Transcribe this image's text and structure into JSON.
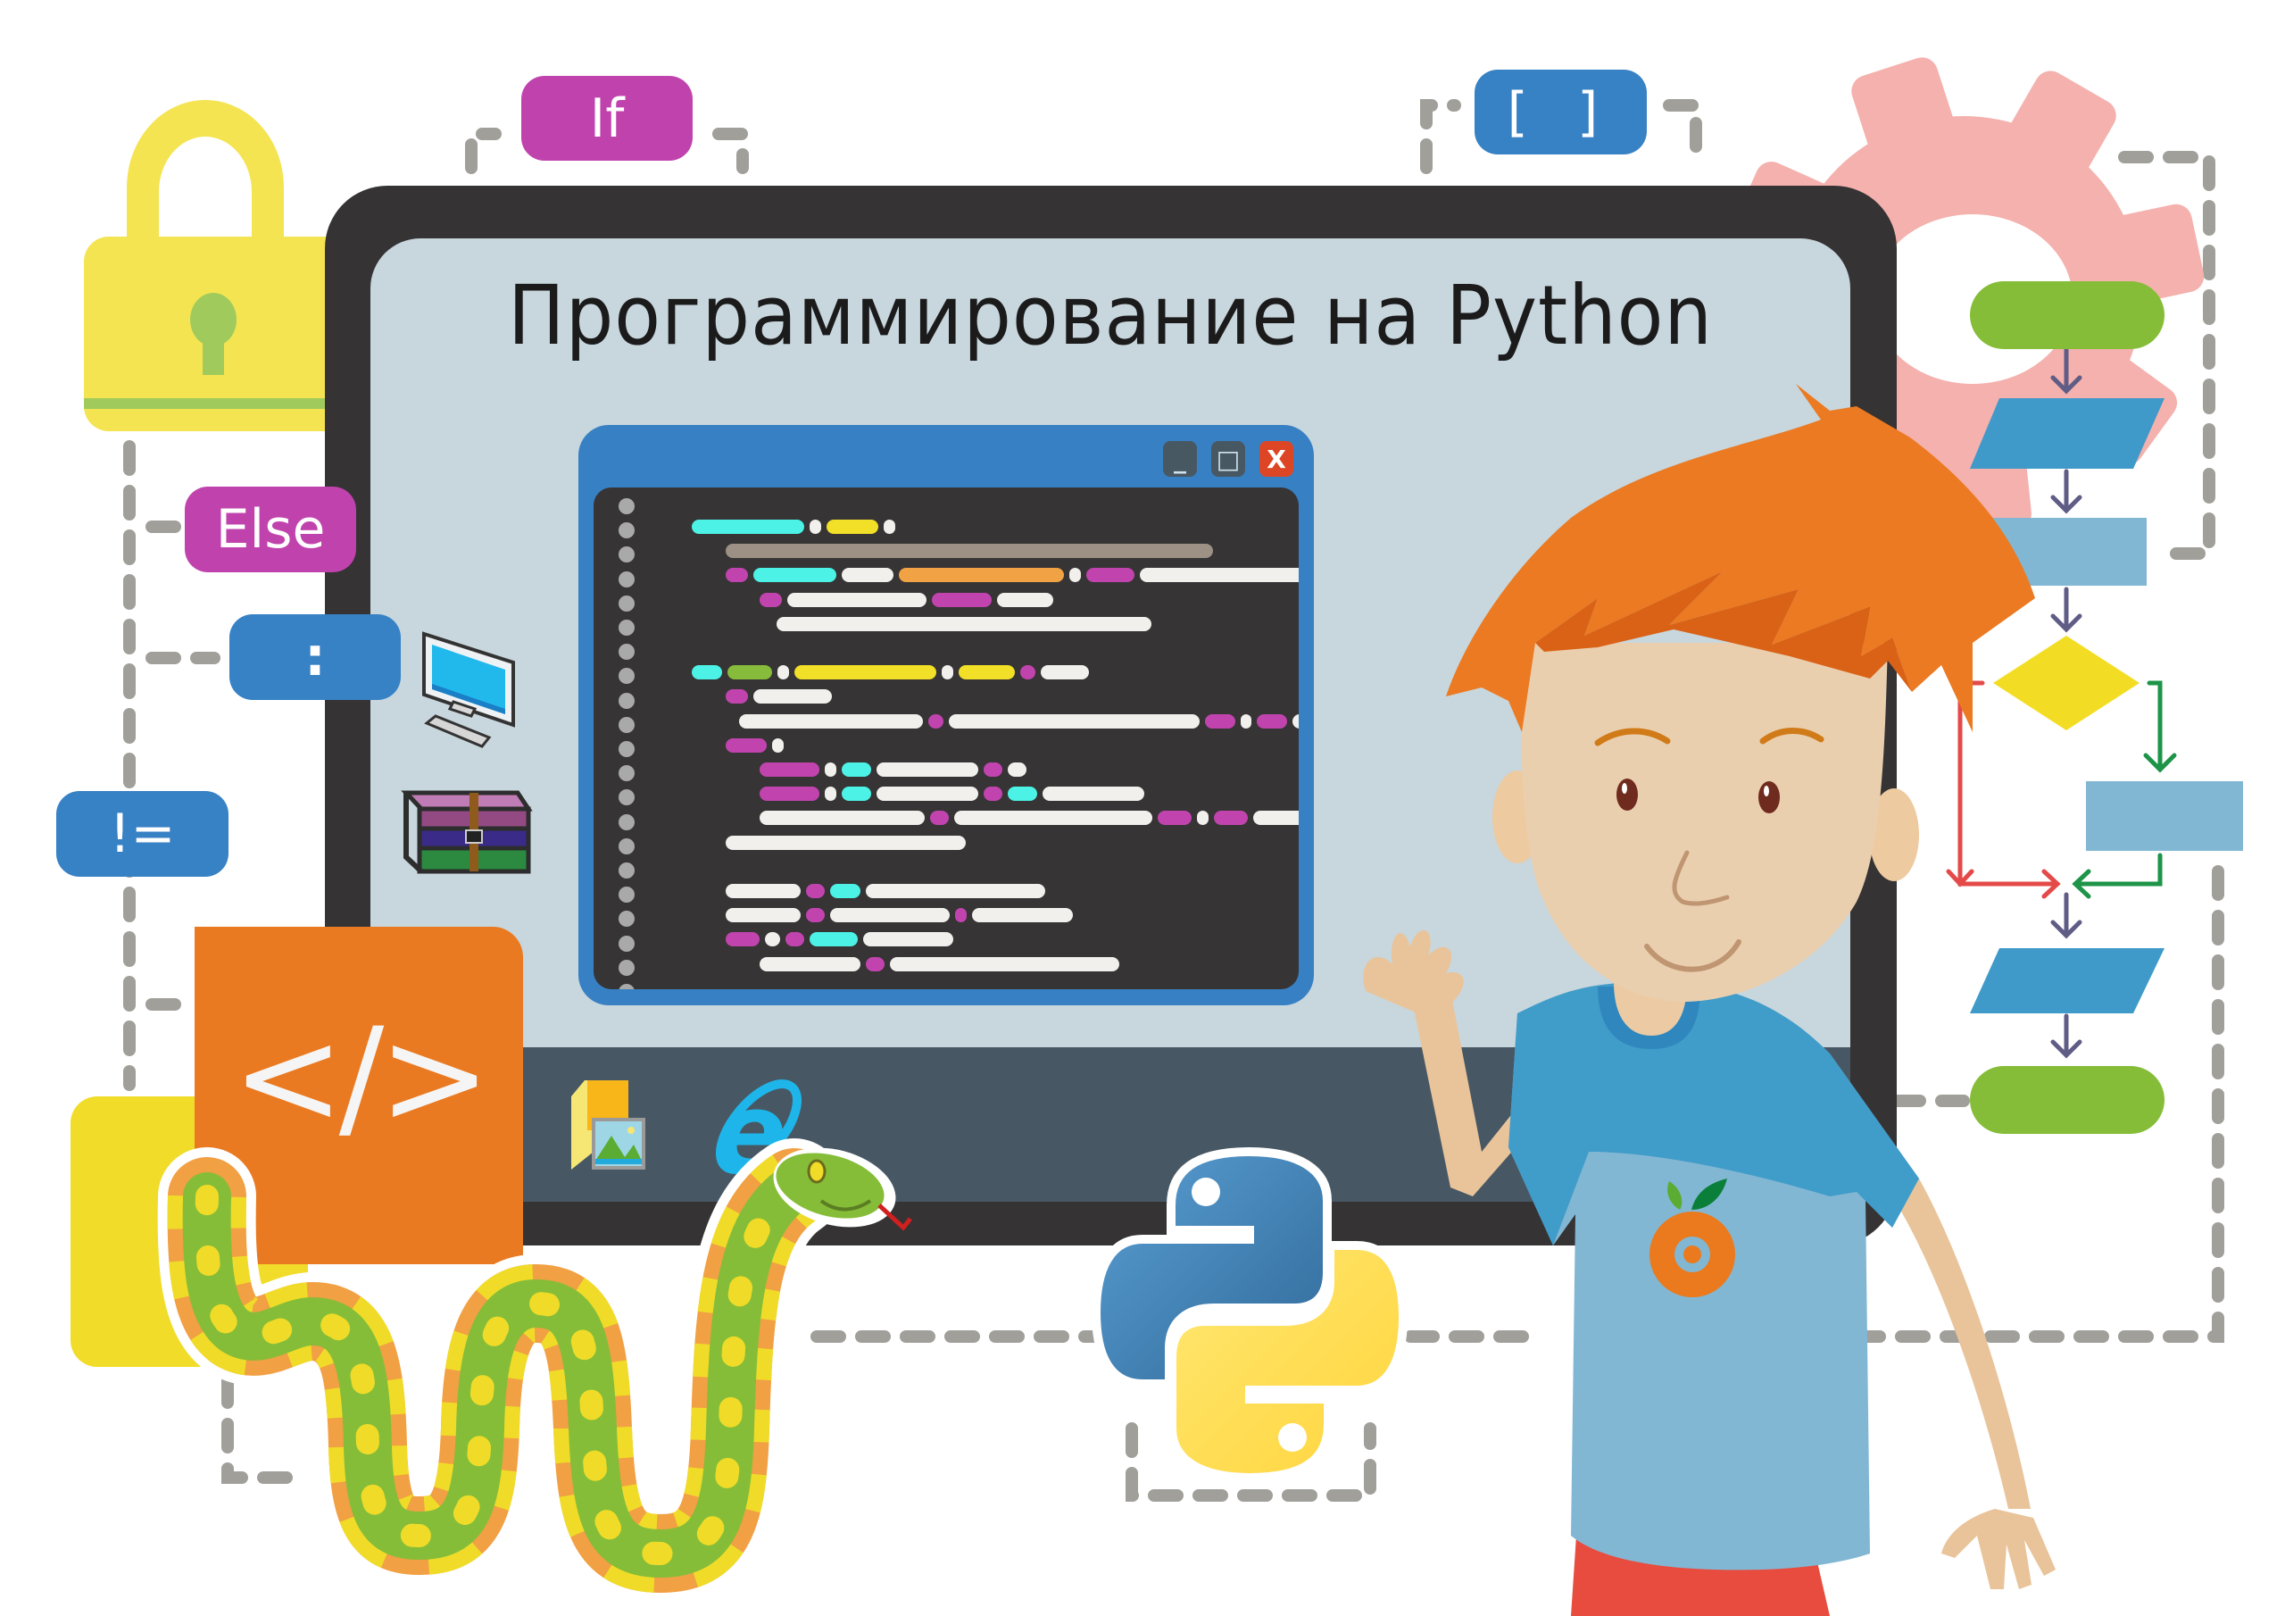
{
  "title": "Программирование на Python",
  "tags": {
    "if": "If",
    "else": "Else",
    "colon": ":",
    "brackets": "[ ]",
    "not_equal": "!="
  },
  "code_window": {
    "minimize_label": "_",
    "maximize_label": "□",
    "close_label": "X"
  },
  "code_icon_label": "</>",
  "shirt_logo": "@",
  "colors": {
    "purple_tag": "#c043ad",
    "blue_tag": "#3781c5",
    "monitor_bezel": "#353334",
    "screen": "#c8d6dd",
    "taskbar": "#475864",
    "code_bg": "#363435",
    "window_frame": "#3880c4",
    "hair": "#eb7a22",
    "flow_green": "#86bd38",
    "flow_blue": "#3f9ac9",
    "flow_lightblue": "#82b7d4",
    "flow_yellow": "#f3dd24",
    "gear_pink": "#f4b1ad",
    "dash_gray": "#a09f9a"
  },
  "icons": [
    "lock-icon",
    "gear-icon",
    "monitor-computer-icon",
    "winrar-archive-icon",
    "folder-image-icon",
    "internet-explorer-icon",
    "code-tag-icon",
    "python-logo-icon",
    "snake-icon",
    "flowchart-diagram"
  ],
  "code_lines": [
    [
      [
        0,
        "c",
        60
      ],
      [
        1,
        "w",
        6
      ],
      [
        2,
        "y",
        28
      ],
      [
        3,
        "w",
        6
      ]
    ],
    [
      [
        0,
        "g",
        260,
        1
      ]
    ],
    [
      [
        0,
        "m",
        12,
        1
      ],
      [
        1,
        "c",
        44
      ],
      [
        2,
        "w",
        28
      ],
      [
        3,
        "o",
        88
      ],
      [
        4,
        "w",
        6
      ],
      [
        5,
        "m",
        26
      ],
      [
        6,
        "w",
        108
      ],
      [
        7,
        "m",
        18
      ],
      [
        8,
        "y",
        14
      ],
      [
        9,
        "w",
        6
      ]
    ],
    [
      [
        0,
        "m",
        12,
        2
      ],
      [
        1,
        "w",
        74
      ],
      [
        2,
        "m",
        32
      ],
      [
        3,
        "w",
        30
      ]
    ],
    [
      [
        0,
        "w",
        200,
        2.5
      ]
    ],
    [],
    [
      [
        0,
        "c",
        16
      ],
      [
        1,
        "gr",
        24
      ],
      [
        2,
        "w",
        6
      ],
      [
        3,
        "y",
        76
      ],
      [
        4,
        "w",
        6
      ],
      [
        5,
        "y",
        30
      ],
      [
        6,
        "m",
        8
      ],
      [
        7,
        "w",
        26
      ]
    ],
    [
      [
        0,
        "m",
        12,
        1
      ],
      [
        1,
        "w",
        42
      ]
    ],
    [
      [
        0,
        "w",
        98,
        1.4
      ],
      [
        1,
        "m",
        8
      ],
      [
        2,
        "w",
        134
      ],
      [
        3,
        "m",
        16
      ],
      [
        4,
        "w",
        6
      ],
      [
        5,
        "m",
        16
      ],
      [
        6,
        "w",
        56
      ]
    ],
    [
      [
        0,
        "m",
        22,
        1
      ],
      [
        1,
        "w",
        6
      ]
    ],
    [
      [
        0,
        "m",
        32,
        2
      ],
      [
        1,
        "w",
        6
      ],
      [
        2,
        "c",
        16
      ],
      [
        3,
        "w",
        54
      ],
      [
        4,
        "m",
        10
      ],
      [
        5,
        "w",
        10
      ]
    ],
    [
      [
        0,
        "m",
        32,
        2
      ],
      [
        1,
        "w",
        6
      ],
      [
        2,
        "c",
        16
      ],
      [
        3,
        "w",
        54
      ],
      [
        4,
        "m",
        10
      ],
      [
        5,
        "c",
        16
      ],
      [
        6,
        "w",
        54
      ]
    ],
    [
      [
        0,
        "w",
        88,
        2
      ],
      [
        1,
        "m",
        10
      ],
      [
        2,
        "w",
        106
      ],
      [
        3,
        "m",
        18
      ],
      [
        4,
        "w",
        6
      ],
      [
        5,
        "m",
        18
      ],
      [
        6,
        "w",
        54
      ]
    ],
    [
      [
        0,
        "w",
        128,
        1
      ]
    ],
    [],
    [
      [
        0,
        "w",
        40,
        1
      ],
      [
        1,
        "m",
        10
      ],
      [
        2,
        "c",
        16
      ],
      [
        3,
        "w",
        96
      ]
    ],
    [
      [
        0,
        "w",
        40,
        1
      ],
      [
        1,
        "m",
        10
      ],
      [
        2,
        "w",
        64
      ],
      [
        3,
        "m",
        6
      ],
      [
        4,
        "w",
        54
      ]
    ],
    [
      [
        0,
        "m",
        18,
        1
      ],
      [
        1,
        "w",
        8
      ],
      [
        2,
        "m",
        10
      ],
      [
        3,
        "c",
        26
      ],
      [
        4,
        "w",
        48
      ]
    ],
    [
      [
        0,
        "w",
        54,
        2
      ],
      [
        1,
        "m",
        10
      ],
      [
        2,
        "w",
        122
      ]
    ],
    [],
    [
      [
        0,
        "w",
        24,
        1
      ],
      [
        1,
        "m",
        10
      ],
      [
        2,
        "w",
        50
      ],
      [
        3,
        "m",
        6
      ],
      [
        4,
        "w",
        44
      ]
    ],
    [
      [
        0,
        "w",
        32,
        1.1
      ],
      [
        1,
        "m",
        10
      ],
      [
        2,
        "w",
        46
      ],
      [
        3,
        "m",
        6
      ],
      [
        4,
        "w",
        40
      ]
    ],
    [
      [
        0,
        "w",
        16,
        1.1
      ],
      [
        1,
        "m",
        10
      ],
      [
        2,
        "w",
        312
      ]
    ],
    [
      [
        0,
        "m",
        34,
        1.1
      ],
      [
        1,
        "w",
        26
      ]
    ]
  ]
}
